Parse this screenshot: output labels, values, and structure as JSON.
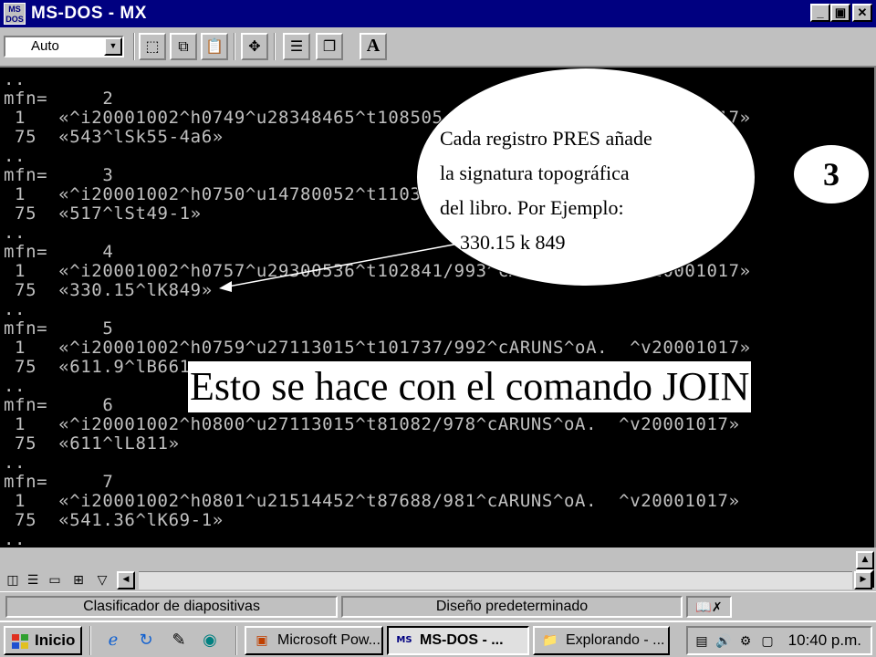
{
  "window": {
    "title": "MS-DOS - MX",
    "app_icon_text": "MS\nDOS"
  },
  "toolbar": {
    "font_select_value": "Auto",
    "buttons": [
      "mark-icon",
      "copy-icon",
      "paste-icon",
      "fullscreen-icon",
      "properties-icon",
      "background-icon",
      "font-icon"
    ],
    "font_button_label": "A"
  },
  "console": {
    "lines": [
      "..",
      "mfn=     2",
      " 1   «^i20001002^h0749^u28348465^t108505/998^cARUNS^oA.  ^v20001017»",
      " 75  «543^lSk55-4a6»",
      "..",
      "mfn=     3",
      " 1   «^i20001002^h0750^u14780052^t110370/000^cARUNS^oA.  ^v20001017»",
      " 75  «517^lSt49-1»",
      "..",
      "mfn=     4",
      " 1   «^i20001002^h0757^u29300536^t102841/993^cARUNS^oA.  ^v20001017»",
      " 75  «330.15^lK849»",
      "..",
      "mfn=     5",
      " 1   «^i20001002^h0759^u27113015^t101737/992^cARUNS^oA.  ^v20001017»",
      " 75  «611.9^lB661»",
      "..",
      "mfn=     6",
      " 1   «^i20001002^h0800^u27113015^t81082/978^cARUNS^oA.  ^v20001017»",
      " 75  «611^lL811»",
      "..",
      "mfn=     7",
      " 1   «^i20001002^h0801^u21514452^t87688/981^cARUNS^oA.  ^v20001017»",
      " 75  «541.36^lK69-1»",
      ".."
    ]
  },
  "annotation": {
    "callout_lines": [
      "Cada registro PRES  añade",
      "la signatura topográfica",
      "del libro. Por Ejemplo:",
      "    330.15 k 849"
    ],
    "step_number": "3",
    "caption": "Esto se hace con el comando JOIN"
  },
  "status_bar": {
    "slide_sorter": "Clasificador de diapositivas",
    "design": "Diseño predeterminado"
  },
  "taskbar": {
    "start_label": "Inicio",
    "tasks": [
      {
        "label": "Microsoft Pow...",
        "icon": "powerpoint-icon",
        "active": false
      },
      {
        "label": "MS-DOS - ...",
        "icon": "msdos-icon",
        "active": true
      },
      {
        "label": "Explorando - ...",
        "icon": "explorer-icon",
        "active": false
      }
    ],
    "clock": "10:40 p.m."
  }
}
